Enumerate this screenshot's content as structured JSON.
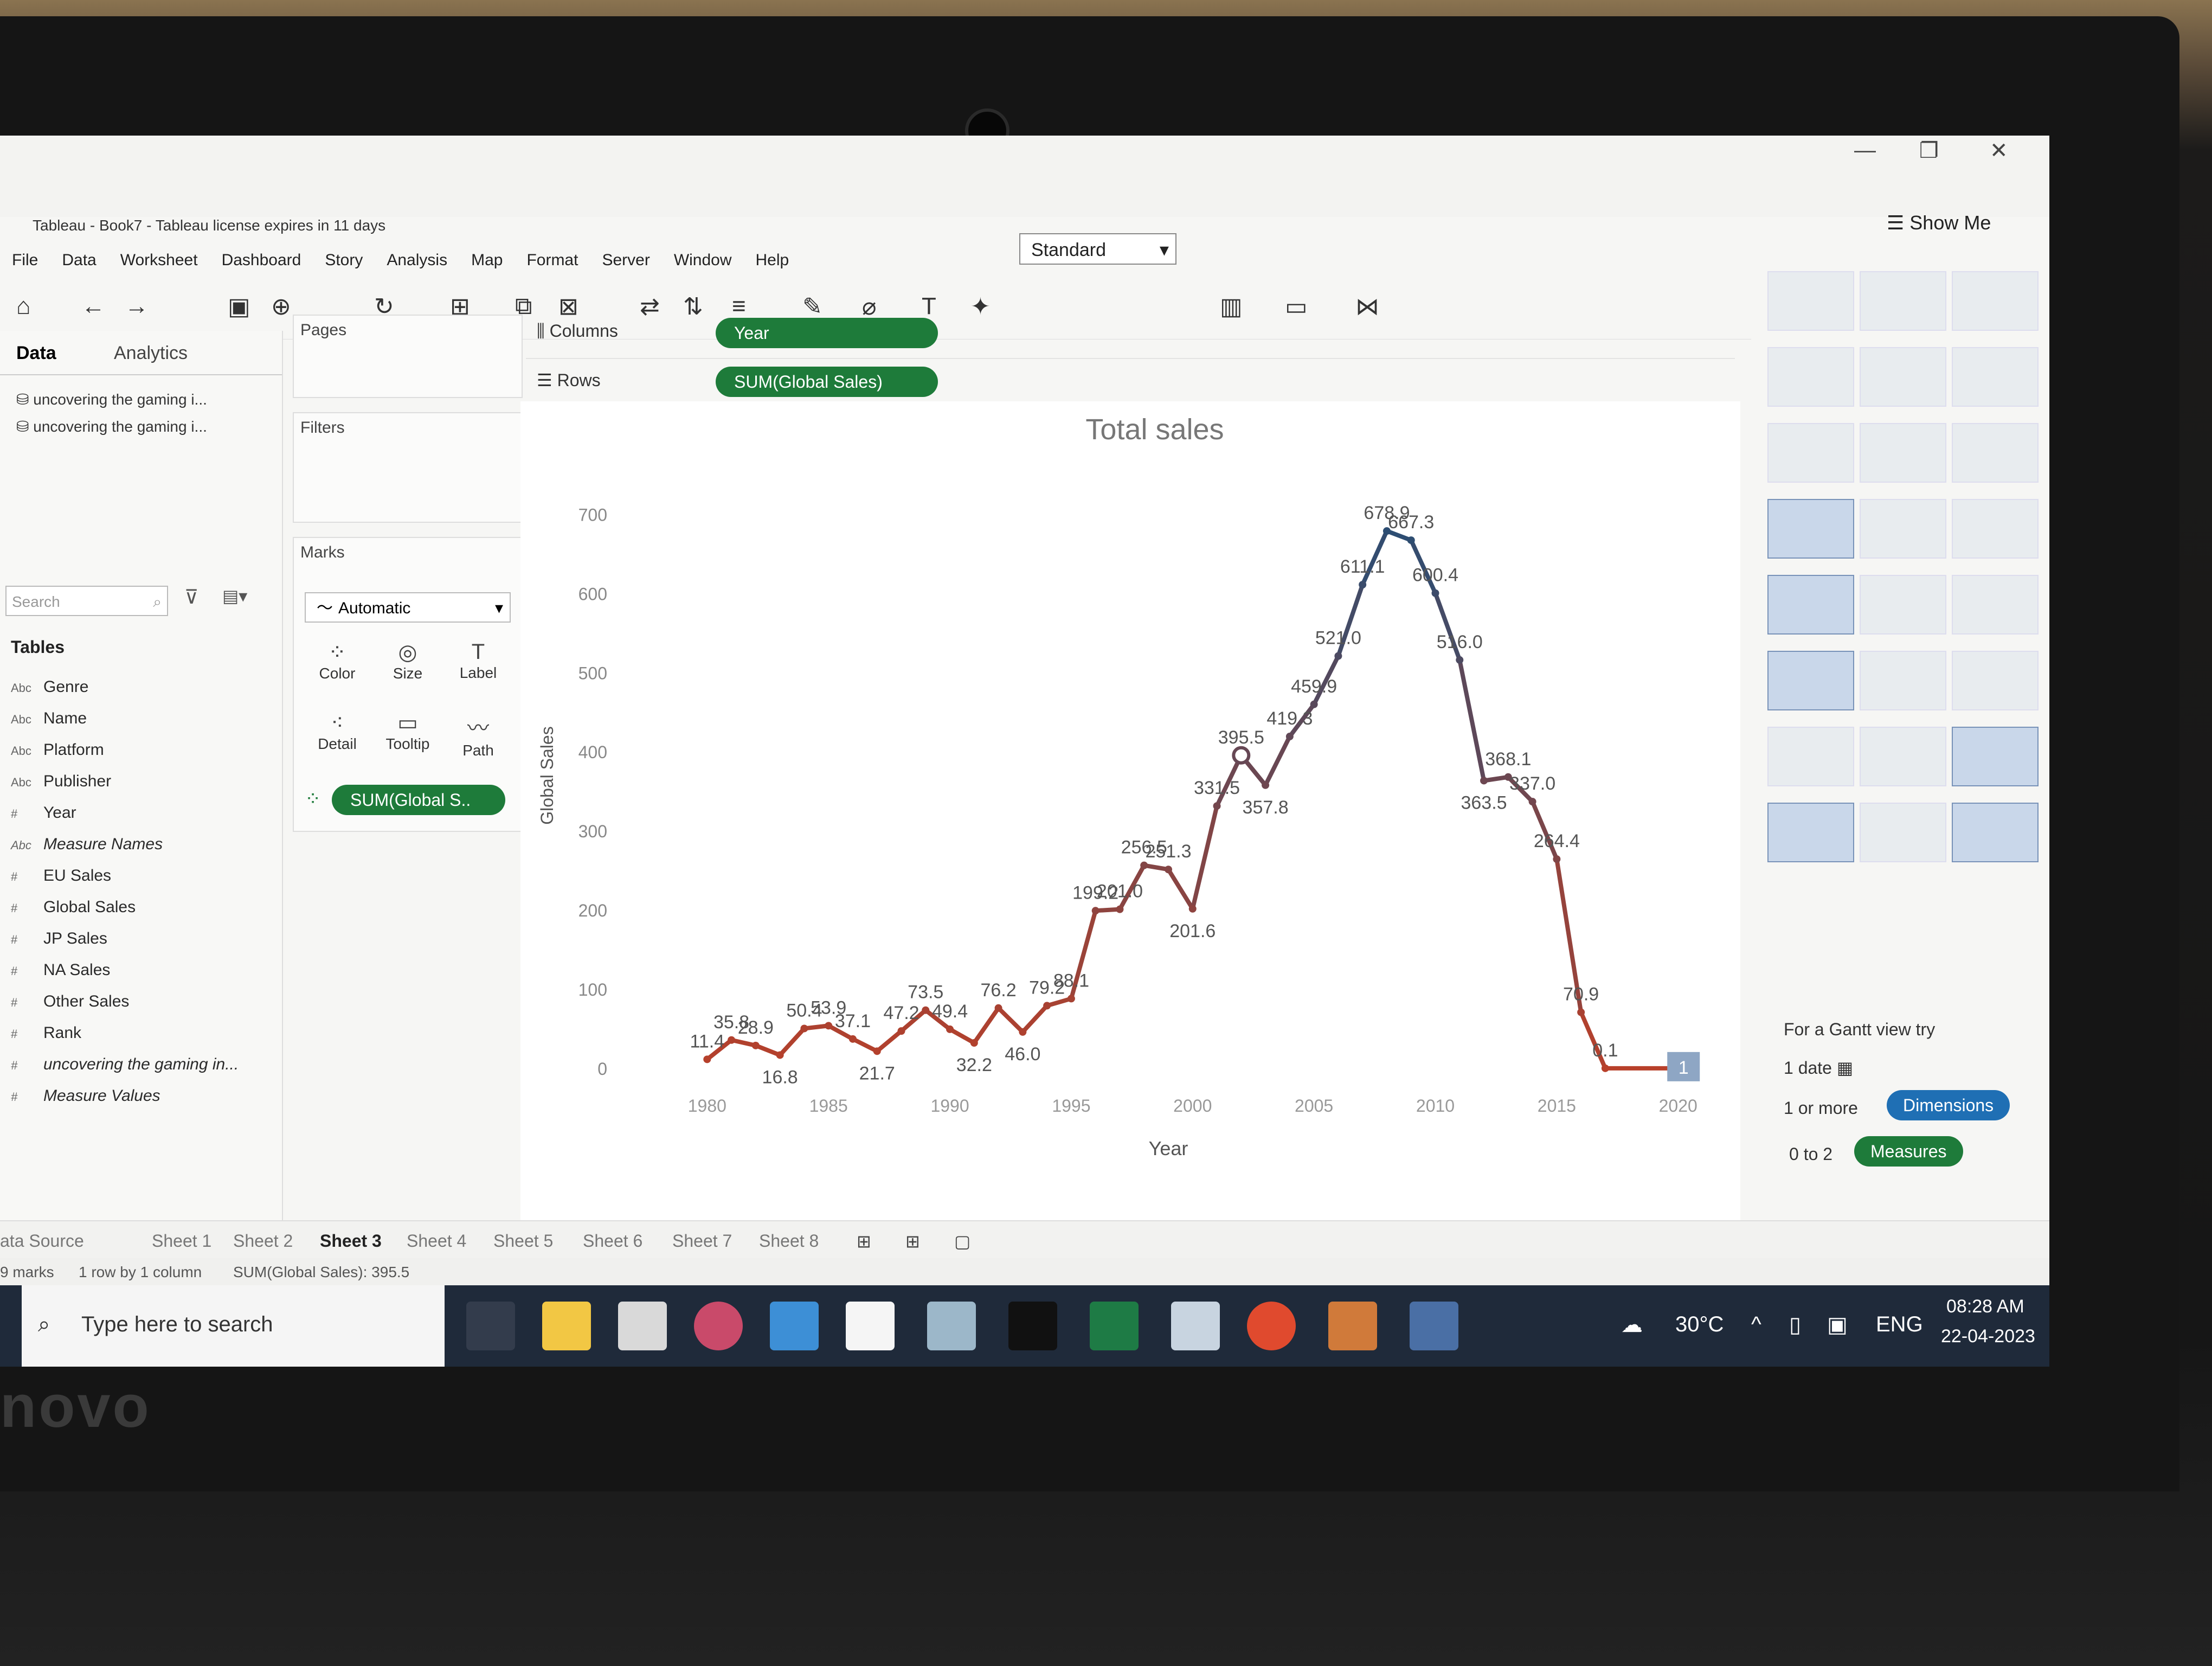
{
  "window": {
    "title": "Tableau - Book7 - Tableau license expires in 11 days",
    "minimize": "—",
    "restore": "❐",
    "close": "✕"
  },
  "menu": [
    "File",
    "Data",
    "Worksheet",
    "Dashboard",
    "Story",
    "Analysis",
    "Map",
    "Format",
    "Server",
    "Window",
    "Help"
  ],
  "toolbar": {
    "fit_select": "Standard",
    "show_me": "Show Me"
  },
  "data_pane": {
    "tab_data": "Data",
    "tab_analytics": "Analytics",
    "datasource_1": "uncovering the gaming i...",
    "datasource_2": "uncovering the gaming i...",
    "search_placeholder": "Search",
    "tables_heading": "Tables",
    "fields": [
      {
        "type": "Abc",
        "name": "Genre"
      },
      {
        "type": "Abc",
        "name": "Name"
      },
      {
        "type": "Abc",
        "name": "Platform"
      },
      {
        "type": "Abc",
        "name": "Publisher"
      },
      {
        "type": "#",
        "name": "Year"
      },
      {
        "type": "Abc",
        "name": "Measure Names"
      },
      {
        "type": "#",
        "name": "EU Sales"
      },
      {
        "type": "#",
        "name": "Global Sales"
      },
      {
        "type": "#",
        "name": "JP Sales"
      },
      {
        "type": "#",
        "name": "NA Sales"
      },
      {
        "type": "#",
        "name": "Other Sales"
      },
      {
        "type": "#",
        "name": "Rank"
      },
      {
        "type": "#",
        "name": "uncovering the gaming in..."
      },
      {
        "type": "#",
        "name": "Measure Values"
      }
    ]
  },
  "shelves": {
    "pages": "Pages",
    "filters": "Filters",
    "marks": "Marks",
    "mark_type": "Automatic",
    "mark_buttons": [
      "Color",
      "Size",
      "Label",
      "Detail",
      "Tooltip",
      "Path"
    ],
    "mark_pill": "SUM(Global S..",
    "columns_label": "Columns",
    "rows_label": "Rows",
    "columns_pill": "Year",
    "rows_pill": "SUM(Global Sales)"
  },
  "chart_data": {
    "type": "line",
    "title": "Total sales",
    "xlabel": "Year",
    "ylabel": "Global Sales",
    "xlim": [
      1977,
      2021
    ],
    "ylim": [
      0,
      740
    ],
    "xticks": [
      1980,
      1985,
      1990,
      1995,
      2000,
      2005,
      2010,
      2015,
      2020
    ],
    "yticks": [
      0,
      100,
      200,
      300,
      400,
      500,
      600,
      700
    ],
    "x": [
      1980,
      1981,
      1982,
      1983,
      1984,
      1985,
      1986,
      1987,
      1988,
      1989,
      1990,
      1991,
      1992,
      1993,
      1994,
      1995,
      1996,
      1997,
      1998,
      1999,
      2000,
      2001,
      2002,
      2003,
      2004,
      2005,
      2006,
      2007,
      2008,
      2009,
      2010,
      2011,
      2012,
      2013,
      2014,
      2015,
      2016,
      2017,
      2020
    ],
    "values": [
      11.4,
      35.8,
      28.9,
      16.8,
      50.4,
      53.9,
      37.1,
      21.7,
      47.2,
      73.5,
      49.4,
      32.2,
      76.2,
      46.0,
      79.2,
      88.1,
      199.2,
      201.0,
      256.5,
      251.3,
      201.6,
      331.5,
      395.5,
      357.8,
      419.3,
      459.9,
      521.0,
      611.1,
      678.9,
      667.3,
      600.4,
      516.0,
      363.5,
      368.1,
      337.0,
      264.4,
      70.9,
      0.1,
      0.1
    ],
    "labels": [
      "11.4",
      "35.8",
      "28.9",
      "16.8",
      "50.4",
      "53.9",
      "37.1",
      "21.7",
      "47.2",
      "73.5",
      "49.4",
      "32.2",
      "76.2",
      "46.0",
      "79.2",
      "88.1",
      "199.2",
      "201.0",
      "256.5",
      "251.3",
      "201.6",
      "331.5",
      "395.5",
      "357.8",
      "419.3",
      "459.9",
      "521.0",
      "611.1",
      "678.9",
      "667.3",
      "600.4",
      "516.0",
      "363.5",
      "368.1",
      "337.0",
      "264.4",
      "70.9",
      "0.1",
      ""
    ],
    "end_box_label": "1",
    "grid": false,
    "color_low": "#b8402a",
    "color_high": "#1f4e79"
  },
  "show_me": {
    "hint_title": "For a Gantt view try",
    "line1": "1 date",
    "line2": "1 or more",
    "line3": "0 to 2",
    "dimensions": "Dimensions",
    "measures": "Measures"
  },
  "sheets": {
    "data_source": "ata Source",
    "tabs": [
      "Sheet 1",
      "Sheet 2",
      "Sheet 3",
      "Sheet 4",
      "Sheet 5",
      "Sheet 6",
      "Sheet 7",
      "Sheet 8"
    ],
    "active": "Sheet 3"
  },
  "status": {
    "marks": "9 marks",
    "dims": "1 row by 1 column",
    "sum": "SUM(Global Sales): 395.5"
  },
  "taskbar": {
    "search_placeholder": "Type here to search",
    "temperature": "30°C",
    "lang": "ENG",
    "time": "08:28 AM",
    "date": "22-04-2023"
  }
}
